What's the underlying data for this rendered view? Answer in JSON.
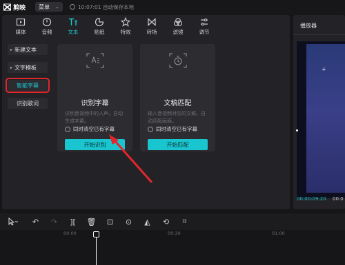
{
  "app": {
    "name": "剪映",
    "menu_label": "菜单",
    "save_status": "10:07:01 自动保存本地"
  },
  "toolbar": {
    "tabs": [
      {
        "label": "媒体",
        "icon": "media-icon"
      },
      {
        "label": "音频",
        "icon": "audio-icon"
      },
      {
        "label": "文本",
        "icon": "text-icon",
        "active": true
      },
      {
        "label": "贴纸",
        "icon": "sticker-icon"
      },
      {
        "label": "特效",
        "icon": "effects-icon"
      },
      {
        "label": "转场",
        "icon": "transition-icon"
      },
      {
        "label": "滤镜",
        "icon": "filter-icon"
      },
      {
        "label": "调节",
        "icon": "adjust-icon"
      }
    ]
  },
  "sub_menu": {
    "items": [
      {
        "label": "新建文本"
      },
      {
        "label": "文字模板"
      },
      {
        "label": "智能字幕",
        "selected": true
      },
      {
        "label": "识别歌词"
      }
    ]
  },
  "cards": [
    {
      "title": "识别字幕",
      "description": "识别音视频中的人声，自动生成字幕。",
      "checkbox_label": "同时清空已有字幕",
      "button_label": "开始识别"
    },
    {
      "title": "文稿匹配",
      "description": "输入音视频对应的文稿，自动匹配画面。",
      "checkbox_label": "同时清空已有字幕",
      "button_label": "开始匹配"
    }
  ],
  "player": {
    "title": "播放器",
    "current_time": "00:00:09:20",
    "total_time": "00:0"
  },
  "timeline": {
    "ticks": [
      "00:00",
      "00:30",
      "01:00"
    ]
  },
  "colors": {
    "accent": "#1fc4cf",
    "highlight": "#e3262b"
  }
}
